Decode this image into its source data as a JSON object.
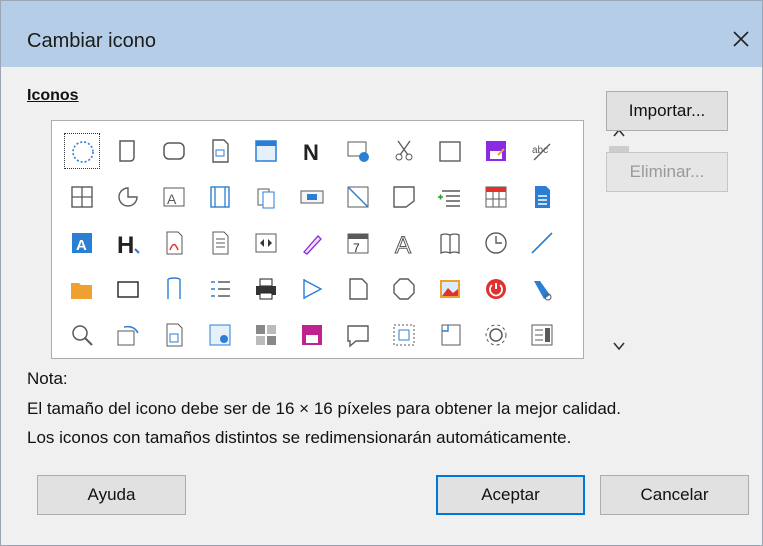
{
  "dialog": {
    "title": "Cambiar icono",
    "section_label": "Iconos",
    "buttons": {
      "import": "Importar...",
      "delete": "Eliminar...",
      "help": "Ayuda",
      "ok": "Aceptar",
      "cancel": "Cancelar"
    },
    "note": {
      "heading": "Nota:",
      "line1": "El tamaño del icono debe ser de 16 × 16 píxeles para obtener la mejor calidad.",
      "line2": "Los iconos con tamaños distintos se redimensionarán automáticamente."
    }
  },
  "colors": {
    "titlebar": "#b6cde8",
    "accent": "#0078d7",
    "icon_blue": "#2a7fd4",
    "icon_purple": "#8a2be2",
    "icon_orange": "#f0a030",
    "icon_red": "#e03030"
  },
  "icons": [
    "dotted-circle-icon",
    "page-frame-icon",
    "rounded-rect-icon",
    "document-form-icon",
    "table-frame-icon",
    "bold-n-icon",
    "image-settings-icon",
    "cut-icon",
    "blank-rect-icon",
    "save-purple-icon",
    "spellcheck-icon",
    "table-grid-icon",
    "arc-shape-icon",
    "text-shape-icon",
    "frame-columns-icon",
    "copy-document-icon",
    "image-button-icon",
    "diagonal-box-icon",
    "callout-shape-icon",
    "insert-list-icon",
    "table-color-icon",
    "document-blue-icon",
    "text-a-icon",
    "heading-h-icon",
    "pdf-document-icon",
    "list-document-icon",
    "column-arrows-icon",
    "pencil-icon",
    "calendar-7-icon",
    "text-a-outline-icon",
    "book-icon",
    "clock-icon",
    "line-diagonal-icon",
    "folder-open-icon",
    "horizontal-rect-icon",
    "bracket-shape-icon",
    "numbered-list-icon",
    "printer-icon",
    "flag-shape-icon",
    "folded-page-icon",
    "octagon-icon",
    "picture-icon",
    "power-icon",
    "eraser-icon",
    "zoom-icon",
    "rotate-shape-icon",
    "document-view-icon",
    "image-frame-icon",
    "pattern-grid-icon",
    "save-magenta-icon",
    "speech-shape-icon",
    "grid-dotted-icon",
    "page-corner-icon",
    "gear-settings-icon",
    "form-fields-icon"
  ]
}
